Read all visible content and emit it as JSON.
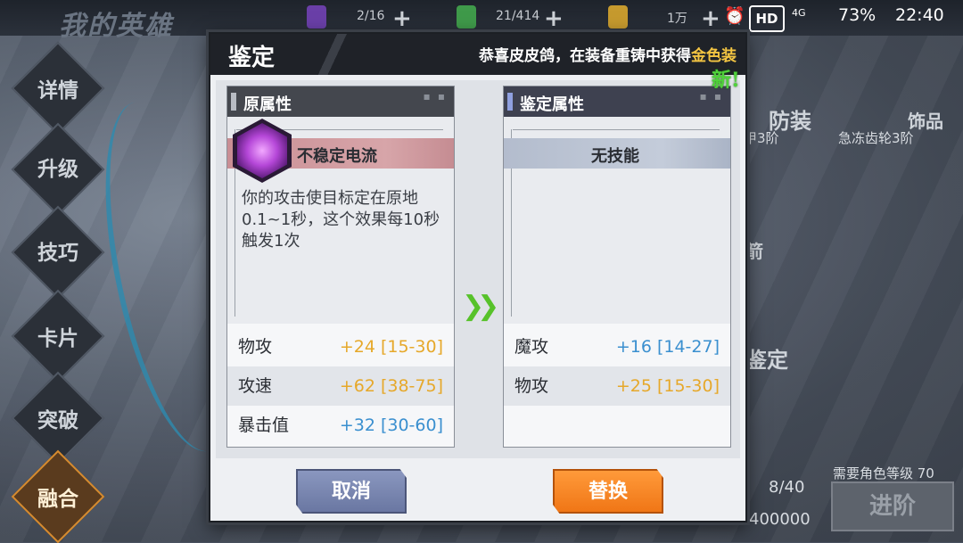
{
  "status_bar": {
    "time": "22:40",
    "battery": "73%",
    "hd": "HD",
    "network": "4G"
  },
  "resources": [
    {
      "value": "2/16"
    },
    {
      "value": "21/414"
    },
    {
      "value": "1万"
    }
  ],
  "page_title": "我的英雄",
  "nav": [
    {
      "label": "详情"
    },
    {
      "label": "升级"
    },
    {
      "label": "技巧"
    },
    {
      "label": "卡片"
    },
    {
      "label": "突破"
    },
    {
      "label": "融合",
      "active": true
    }
  ],
  "background_right": {
    "armor_label": "防装",
    "armor_sub": "甲3阶",
    "accessory_label": "饰品",
    "accessory_sub": "急冻齿轮3阶",
    "weapon_label": "箭",
    "appraise_label": "鉴定",
    "required_level": "需要角色等级 70",
    "progress": "8/40",
    "cost": "400000",
    "advance_button": "进阶"
  },
  "modal": {
    "title": "鉴定",
    "message_prefix": "恭喜皮皮鸽，在装备重铸中获得",
    "message_highlight": "金色装",
    "new_badge": "新!",
    "left_panel": {
      "header": "原属性",
      "skill_name": "不稳定电流",
      "skill_desc": "你的攻击使目标定在原地0.1~1秒，这个效果每10秒触发1次",
      "stats": [
        {
          "name": "物攻",
          "value": "+24 [15-30]",
          "color": "gold"
        },
        {
          "name": "攻速",
          "value": "+62 [38-75]",
          "color": "gold"
        },
        {
          "name": "暴击值",
          "value": "+32 [30-60]",
          "color": "blue"
        }
      ]
    },
    "right_panel": {
      "header": "鉴定属性",
      "skill_name": "无技能",
      "stats": [
        {
          "name": "魔攻",
          "value": "+16 [14-27]",
          "color": "blue"
        },
        {
          "name": "物攻",
          "value": "+25 [15-30]",
          "color": "gold"
        }
      ]
    },
    "cancel_button": "取消",
    "replace_button": "替换"
  }
}
